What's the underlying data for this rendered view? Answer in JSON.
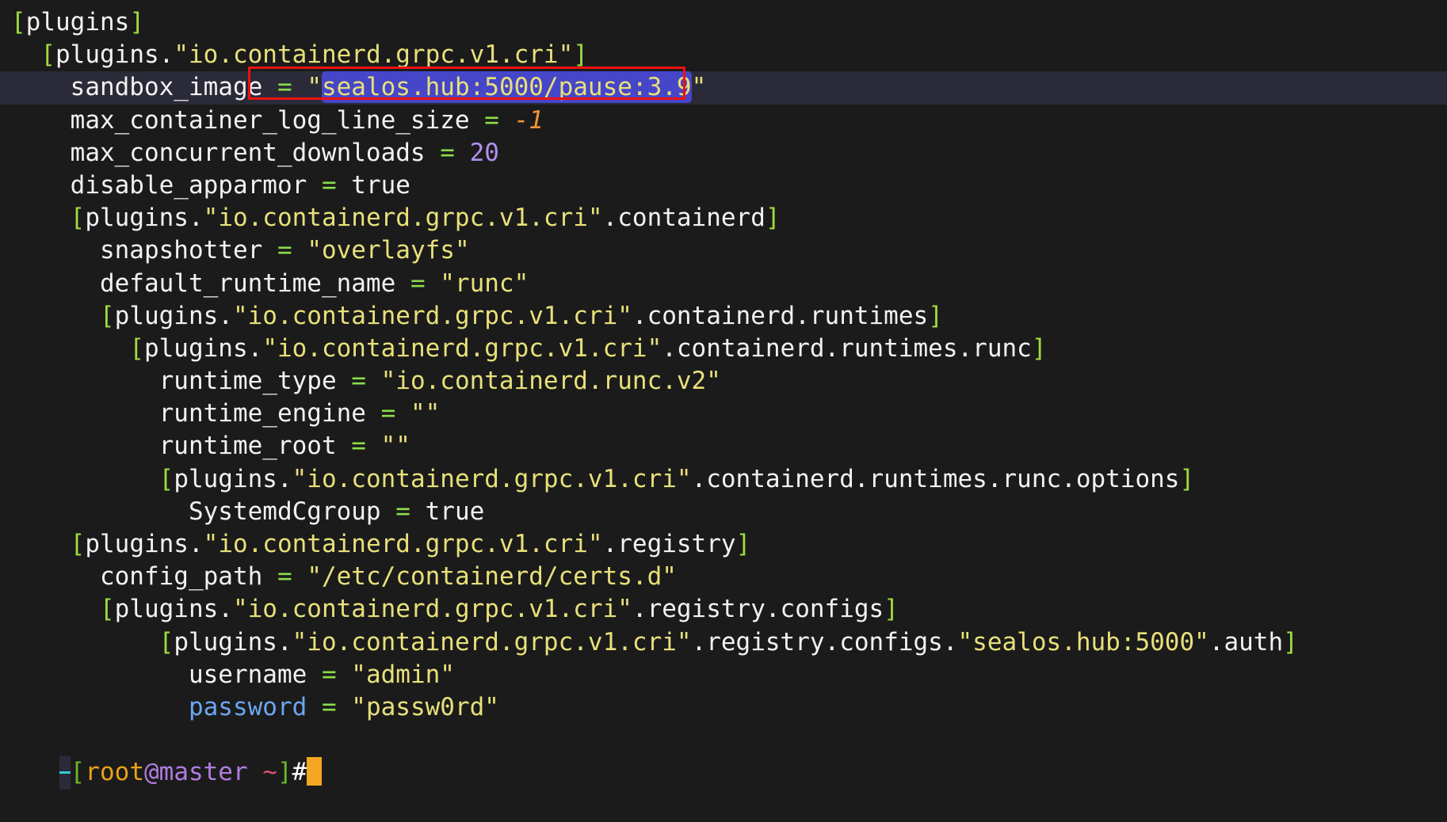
{
  "terminal": {
    "background_color": "#1b1b1b",
    "current_line_color": "#2a2a38",
    "selection_color": "#4646c8",
    "annotation_color": "#ee1111",
    "cursor_color": "#f5a623"
  },
  "code_lines": [
    {
      "indent": 0,
      "segments": [
        {
          "c": "bracket",
          "t": "["
        },
        {
          "c": "key",
          "t": "plugins"
        },
        {
          "c": "bracket",
          "t": "]"
        }
      ]
    },
    {
      "indent": 2,
      "segments": [
        {
          "c": "bracket",
          "t": "["
        },
        {
          "c": "key",
          "t": "plugins"
        },
        {
          "c": "dot",
          "t": "."
        },
        {
          "c": "string",
          "t": "\"io.containerd.grpc.v1.cri\""
        },
        {
          "c": "bracket",
          "t": "]"
        }
      ]
    },
    {
      "indent": 4,
      "current": true,
      "segments": [
        {
          "c": "key",
          "t": "sandbox_image"
        },
        {
          "c": "plain",
          "t": " "
        },
        {
          "c": "eq",
          "t": "="
        },
        {
          "c": "plain",
          "t": " "
        },
        {
          "c": "string",
          "t": "\""
        },
        {
          "c": "string-sel",
          "t": "sealos.hub:5000/pause:3.9"
        },
        {
          "c": "string",
          "t": "\""
        }
      ]
    },
    {
      "indent": 4,
      "segments": [
        {
          "c": "key",
          "t": "max_container_log_line_size"
        },
        {
          "c": "plain",
          "t": " "
        },
        {
          "c": "eq",
          "t": "="
        },
        {
          "c": "plain",
          "t": " "
        },
        {
          "c": "numneg",
          "t": "-1"
        }
      ]
    },
    {
      "indent": 4,
      "segments": [
        {
          "c": "key",
          "t": "max_concurrent_downloads"
        },
        {
          "c": "plain",
          "t": " "
        },
        {
          "c": "eq",
          "t": "="
        },
        {
          "c": "plain",
          "t": " "
        },
        {
          "c": "num",
          "t": "20"
        }
      ]
    },
    {
      "indent": 4,
      "segments": [
        {
          "c": "key",
          "t": "disable_apparmor"
        },
        {
          "c": "plain",
          "t": " "
        },
        {
          "c": "eq",
          "t": "="
        },
        {
          "c": "plain",
          "t": " "
        },
        {
          "c": "bool",
          "t": "true"
        }
      ]
    },
    {
      "indent": 4,
      "segments": [
        {
          "c": "bracket",
          "t": "["
        },
        {
          "c": "key",
          "t": "plugins"
        },
        {
          "c": "dot",
          "t": "."
        },
        {
          "c": "string",
          "t": "\"io.containerd.grpc.v1.cri\""
        },
        {
          "c": "dot",
          "t": ".containerd"
        },
        {
          "c": "bracket",
          "t": "]"
        }
      ]
    },
    {
      "indent": 6,
      "segments": [
        {
          "c": "key",
          "t": "snapshotter"
        },
        {
          "c": "plain",
          "t": " "
        },
        {
          "c": "eq",
          "t": "="
        },
        {
          "c": "plain",
          "t": " "
        },
        {
          "c": "string",
          "t": "\"overlayfs\""
        }
      ]
    },
    {
      "indent": 6,
      "segments": [
        {
          "c": "key",
          "t": "default_runtime_name"
        },
        {
          "c": "plain",
          "t": " "
        },
        {
          "c": "eq",
          "t": "="
        },
        {
          "c": "plain",
          "t": " "
        },
        {
          "c": "string",
          "t": "\"runc\""
        }
      ]
    },
    {
      "indent": 6,
      "segments": [
        {
          "c": "bracket",
          "t": "["
        },
        {
          "c": "key",
          "t": "plugins"
        },
        {
          "c": "dot",
          "t": "."
        },
        {
          "c": "string",
          "t": "\"io.containerd.grpc.v1.cri\""
        },
        {
          "c": "dot",
          "t": ".containerd.runtimes"
        },
        {
          "c": "bracket",
          "t": "]"
        }
      ]
    },
    {
      "indent": 8,
      "segments": [
        {
          "c": "bracket",
          "t": "["
        },
        {
          "c": "key",
          "t": "plugins"
        },
        {
          "c": "dot",
          "t": "."
        },
        {
          "c": "string",
          "t": "\"io.containerd.grpc.v1.cri\""
        },
        {
          "c": "dot",
          "t": ".containerd.runtimes.runc"
        },
        {
          "c": "bracket",
          "t": "]"
        }
      ]
    },
    {
      "indent": 10,
      "segments": [
        {
          "c": "key",
          "t": "runtime_type"
        },
        {
          "c": "plain",
          "t": " "
        },
        {
          "c": "eq",
          "t": "="
        },
        {
          "c": "plain",
          "t": " "
        },
        {
          "c": "string",
          "t": "\"io.containerd.runc.v2\""
        }
      ]
    },
    {
      "indent": 10,
      "segments": [
        {
          "c": "key",
          "t": "runtime_engine"
        },
        {
          "c": "plain",
          "t": " "
        },
        {
          "c": "eq",
          "t": "="
        },
        {
          "c": "plain",
          "t": " "
        },
        {
          "c": "string",
          "t": "\"\""
        }
      ]
    },
    {
      "indent": 10,
      "segments": [
        {
          "c": "key",
          "t": "runtime_root"
        },
        {
          "c": "plain",
          "t": " "
        },
        {
          "c": "eq",
          "t": "="
        },
        {
          "c": "plain",
          "t": " "
        },
        {
          "c": "string",
          "t": "\"\""
        }
      ]
    },
    {
      "indent": 10,
      "segments": [
        {
          "c": "bracket",
          "t": "["
        },
        {
          "c": "key",
          "t": "plugins"
        },
        {
          "c": "dot",
          "t": "."
        },
        {
          "c": "string",
          "t": "\"io.containerd.grpc.v1.cri\""
        },
        {
          "c": "dot",
          "t": ".containerd.runtimes.runc.options"
        },
        {
          "c": "bracket",
          "t": "]"
        }
      ]
    },
    {
      "indent": 12,
      "segments": [
        {
          "c": "key",
          "t": "SystemdCgroup"
        },
        {
          "c": "plain",
          "t": " "
        },
        {
          "c": "eq",
          "t": "="
        },
        {
          "c": "plain",
          "t": " "
        },
        {
          "c": "bool",
          "t": "true"
        }
      ]
    },
    {
      "indent": 4,
      "segments": [
        {
          "c": "bracket",
          "t": "["
        },
        {
          "c": "key",
          "t": "plugins"
        },
        {
          "c": "dot",
          "t": "."
        },
        {
          "c": "string",
          "t": "\"io.containerd.grpc.v1.cri\""
        },
        {
          "c": "dot",
          "t": ".registry"
        },
        {
          "c": "bracket",
          "t": "]"
        }
      ]
    },
    {
      "indent": 6,
      "segments": [
        {
          "c": "key",
          "t": "config_path"
        },
        {
          "c": "plain",
          "t": " "
        },
        {
          "c": "eq",
          "t": "="
        },
        {
          "c": "plain",
          "t": " "
        },
        {
          "c": "string",
          "t": "\"/etc/containerd/certs.d\""
        }
      ]
    },
    {
      "indent": 6,
      "segments": [
        {
          "c": "bracket",
          "t": "["
        },
        {
          "c": "key",
          "t": "plugins"
        },
        {
          "c": "dot",
          "t": "."
        },
        {
          "c": "string",
          "t": "\"io.containerd.grpc.v1.cri\""
        },
        {
          "c": "dot",
          "t": ".registry.configs"
        },
        {
          "c": "bracket",
          "t": "]"
        }
      ]
    },
    {
      "indent": 10,
      "segments": [
        {
          "c": "bracket",
          "t": "["
        },
        {
          "c": "key",
          "t": "plugins"
        },
        {
          "c": "dot",
          "t": "."
        },
        {
          "c": "string",
          "t": "\"io.containerd.grpc.v1.cri\""
        },
        {
          "c": "dot",
          "t": ".registry.configs."
        },
        {
          "c": "string",
          "t": "\"sealos.hub:5000\""
        },
        {
          "c": "dot",
          "t": ".auth"
        },
        {
          "c": "bracket",
          "t": "]"
        }
      ]
    },
    {
      "indent": 12,
      "segments": [
        {
          "c": "key",
          "t": "username"
        },
        {
          "c": "plain",
          "t": " "
        },
        {
          "c": "eq",
          "t": "="
        },
        {
          "c": "plain",
          "t": " "
        },
        {
          "c": "string",
          "t": "\"admin\""
        }
      ]
    },
    {
      "indent": 12,
      "segments": [
        {
          "c": "pwkey",
          "t": "password"
        },
        {
          "c": "plain",
          "t": " "
        },
        {
          "c": "eq",
          "t": "="
        },
        {
          "c": "plain",
          "t": " "
        },
        {
          "c": "string",
          "t": "\"passw0rd\""
        }
      ]
    }
  ],
  "prompt": {
    "open_bracket": "[",
    "user": "root",
    "at": "@",
    "host": "master",
    "space": " ",
    "tilde": "~",
    "close_bracket": "]",
    "symbol": "#",
    "command": ""
  }
}
